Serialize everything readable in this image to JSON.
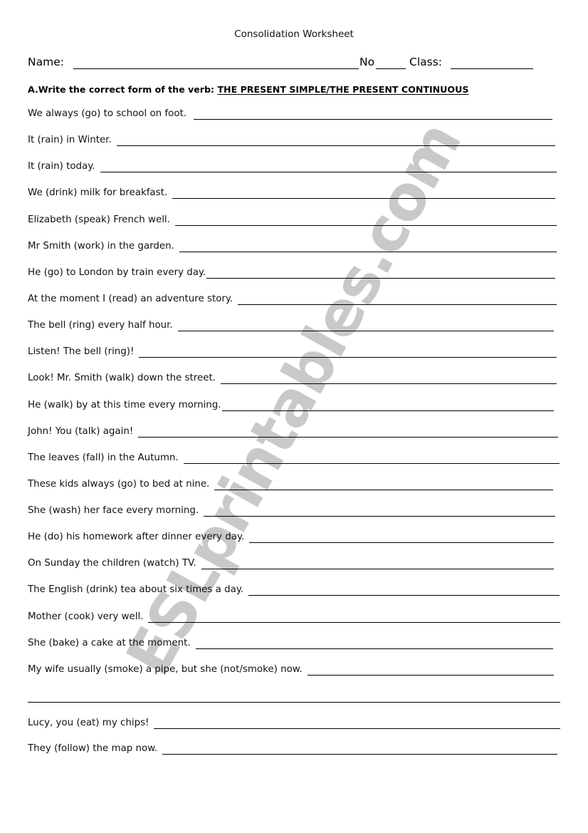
{
  "document": {
    "title": "Consolidation Worksheet",
    "watermark": "ESLprintables.com"
  },
  "header": {
    "name_label": "Name:",
    "number_label": "No",
    "class_label": "Class:"
  },
  "section_a": {
    "instruction": "A.Write the correct form of the verb: ",
    "tenses": "THE PRESENT SIMPLE/THE PRESENT CONTINUOUS",
    "items": [
      "We always (go) to school on foot.",
      "It (rain) in Winter.",
      "It (rain) today.",
      "We (drink) milk for breakfast.",
      "Elizabeth (speak) French well.",
      "Mr Smith (work) in the garden.",
      "He (go) to London by train every day.",
      "At the moment I (read) an adventure story.",
      "The bell (ring) every half hour.",
      "Listen! The bell (ring)!",
      "Look! Mr. Smith (walk) down the street.",
      "He (walk) by at this time every morning.",
      "John! You (talk) again!",
      "The leaves (fall) in the Autumn.",
      "These kids always (go) to bed at nine.",
      "She (wash) her face every morning.",
      "He (do) his homework after dinner every day.",
      "On Sunday the children (watch) TV.",
      "The English (drink) tea about six times a day.",
      "Mother (cook) very well.",
      "She (bake) a cake at the moment.",
      "My wife usually (smoke) a pipe, but she (not/smoke) now.",
      "Lucy, you (eat) my chips!",
      "They (follow) the map now."
    ]
  }
}
